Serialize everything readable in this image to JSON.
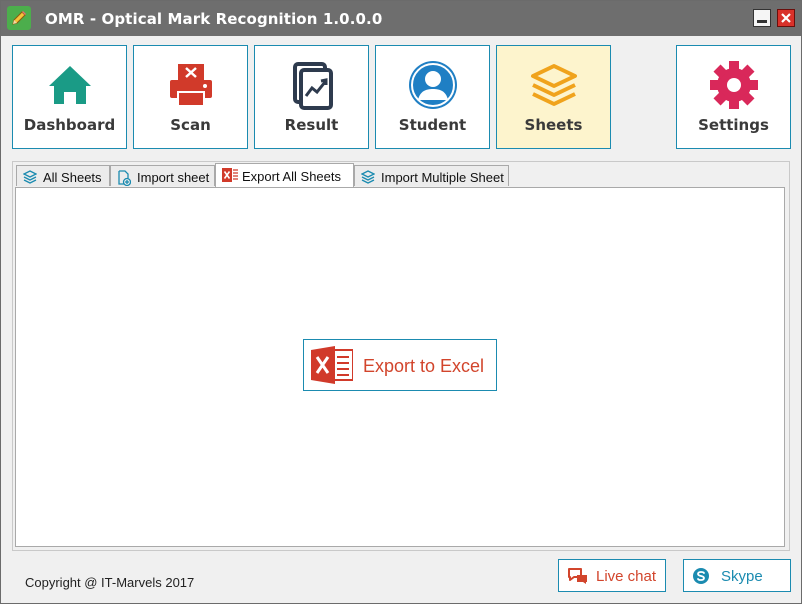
{
  "window": {
    "title": "OMR - Optical Mark Recognition 1.0.0.0",
    "app_icon": "pencil-icon"
  },
  "nav": {
    "items": [
      {
        "label": "Dashboard",
        "icon": "home-icon",
        "color": "#1a9b86",
        "active": false
      },
      {
        "label": "Scan",
        "icon": "printer-x-icon",
        "color": "#d13a2a",
        "active": false
      },
      {
        "label": "Result",
        "icon": "chart-document-icon",
        "color": "#2e3b4e",
        "active": false
      },
      {
        "label": "Student",
        "icon": "user-icon",
        "color": "#1f7fc4",
        "active": false
      },
      {
        "label": "Sheets",
        "icon": "layers-icon",
        "color": "#f0a31c",
        "active": true
      },
      {
        "label": "Settings",
        "icon": "gear-icon",
        "color": "#d9285a",
        "active": false
      }
    ]
  },
  "tabs": [
    {
      "label": "All Sheets",
      "icon": "layers-icon",
      "active": false
    },
    {
      "label": "Import sheet",
      "icon": "file-add-icon",
      "active": false
    },
    {
      "label": "Export All Sheets",
      "icon": "excel-icon",
      "active": true
    },
    {
      "label": "Import Multiple Sheet",
      "icon": "layers-icon",
      "active": false
    }
  ],
  "main": {
    "export_button_label": "Export to Excel",
    "export_button_icon": "excel-icon"
  },
  "footer": {
    "copyright": "Copyright @ IT-Marvels 2017",
    "live_chat_label": "Live chat",
    "live_chat_icon": "chat-bubbles-icon",
    "skype_label": "Skype",
    "skype_icon": "skype-icon"
  },
  "colors": {
    "accent_border": "#1b8bb0",
    "active_tile_bg": "#fdf4cd",
    "titlebar": "#6e6e6e",
    "excel_red": "#d2452c"
  }
}
